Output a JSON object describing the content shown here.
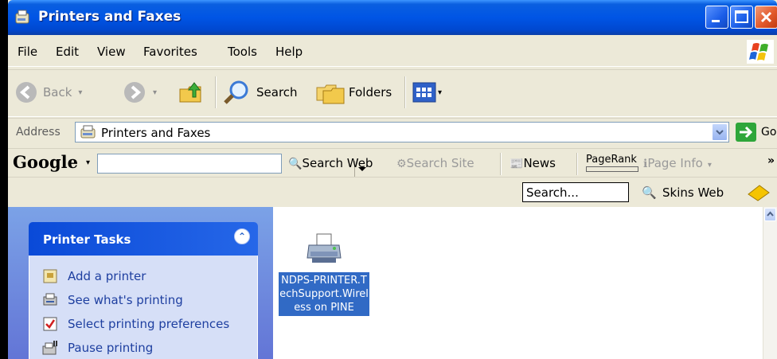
{
  "window": {
    "title": "Printers and Faxes"
  },
  "menu": [
    {
      "label": "File"
    },
    {
      "label": "Edit"
    },
    {
      "label": "View"
    },
    {
      "label": "Favorites"
    },
    {
      "label": "Tools"
    },
    {
      "label": "Help"
    }
  ],
  "toolbar": {
    "back_label": "Back",
    "search_label": "Search",
    "folders_label": "Folders"
  },
  "address": {
    "label": "Address",
    "value": "Printers and Faxes",
    "go_label": "Go"
  },
  "google": {
    "logo": "Google",
    "search_web": "Search Web",
    "search_site": "Search Site",
    "news": "News",
    "pagerank": "PageRank",
    "page_info": "Page Info"
  },
  "skins": {
    "search_placeholder": "Search...",
    "skins_web_label": "Skins Web"
  },
  "task_pane": {
    "title": "Printer Tasks",
    "items": [
      {
        "label": "Add a printer"
      },
      {
        "label": "See what's printing"
      },
      {
        "label": "Select printing preferences"
      },
      {
        "label": "Pause printing"
      }
    ]
  },
  "printer": {
    "name": "NDPS-PRINTER.TechSupport.Wireless on PINE"
  },
  "colors": {
    "titlebar": "#0055e5",
    "selection": "#316ac5",
    "task_link": "#1e3fa0"
  }
}
